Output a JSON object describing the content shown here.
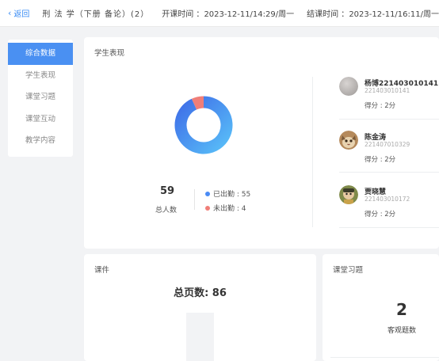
{
  "topbar": {
    "back_label": "返回",
    "course_title": "刑 法 学（下册 备论）(2）",
    "start_time_label": "开课时间 ：",
    "start_time": "2023-12-11/14:29/周一",
    "end_time_label": "结课时间 ：",
    "end_time": "2023-12-11/16:11/周一"
  },
  "sidebar": {
    "items": [
      {
        "label": "综合数据",
        "active": true
      },
      {
        "label": "学生表现",
        "active": false
      },
      {
        "label": "课堂习题",
        "active": false
      },
      {
        "label": "课堂互动",
        "active": false
      },
      {
        "label": "教学内容",
        "active": false
      }
    ]
  },
  "student_performance": {
    "title": "学生表现",
    "total": "59",
    "total_label": "总人数",
    "present_label": "已出勤 : 55",
    "absent_label": "未出勤 : 4",
    "present_count": 55,
    "absent_count": 4,
    "colors": {
      "present": "#4a8bf5",
      "absent": "#f07e78"
    },
    "students": [
      {
        "name": "杨博221403010141",
        "id": "221403010141",
        "score": "得分 : 2分",
        "avatar": "gray-circle"
      },
      {
        "name": "陈金涛",
        "id": "221407010329",
        "score": "得分 : 2分",
        "avatar": "cat-photo"
      },
      {
        "name": "贾晓慧",
        "id": "221403010172",
        "score": "得分 : 2分",
        "avatar": "cartoon-photo"
      }
    ]
  },
  "courseware": {
    "title": "课件",
    "total_pages": "总页数: 86"
  },
  "exercise": {
    "title": "课堂习题",
    "objective_count": "2",
    "objective_label": "客观题数"
  }
}
